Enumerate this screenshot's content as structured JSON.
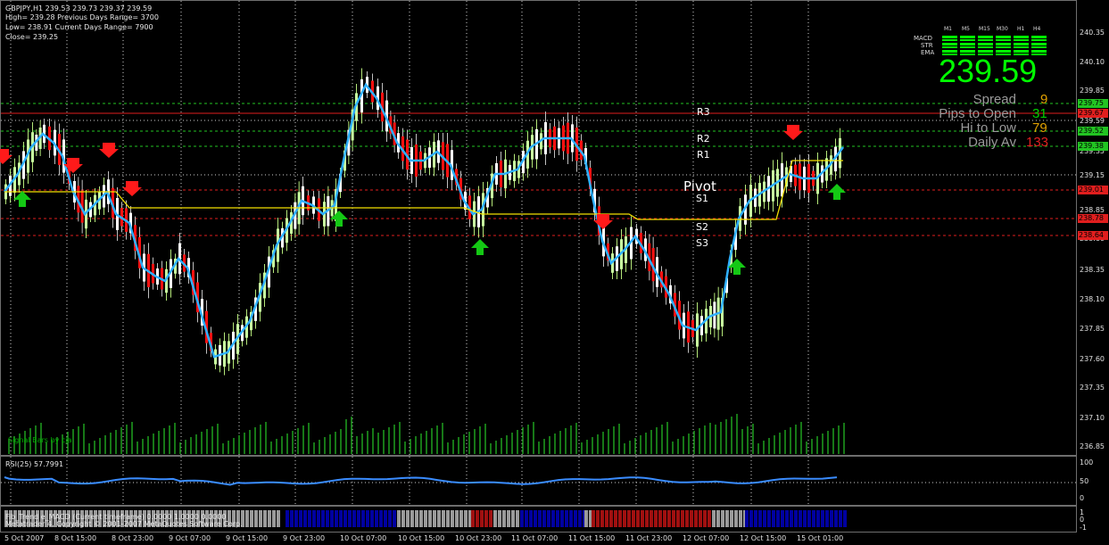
{
  "header": {
    "line1": "GBPJPY,H1  239.53 239.73 239.37 239.59",
    "line2": "High= 239.28    Previous Days Range= 3700",
    "line3": "Low= 238.91    Current Days Range= 7900",
    "line4": "Close= 239.25"
  },
  "indicator_panel": {
    "timeframes": [
      "M1",
      "M5",
      "M15",
      "M30",
      "H1",
      "H4"
    ],
    "rows": [
      "MACD",
      "STR",
      "EMA"
    ],
    "price": "239.59",
    "spread_label": "Spread",
    "spread_value": "9",
    "pips_label": "Pips to Open",
    "pips_value": "31",
    "hilo_label": "Hi to Low",
    "hilo_value": "79",
    "daily_label": "Daily Av",
    "daily_value": "133",
    "colors": {
      "green": "#00ff00",
      "gray": "#9a9a9a",
      "red": "#e02020",
      "orange": "#e0a000"
    }
  },
  "pivot_labels": {
    "r3": "R3",
    "r2": "R2",
    "r1": "R1",
    "pivot": "Pivot",
    "s1": "S1",
    "s2": "S2",
    "s3": "S3"
  },
  "price_axis": [
    "240.35",
    "240.10",
    "239.85",
    "239.59",
    "239.35",
    "239.15",
    "238.85",
    "238.60",
    "238.35",
    "238.10",
    "237.85",
    "237.60",
    "237.35",
    "237.10",
    "236.85"
  ],
  "price_tags": [
    {
      "text": "239.75",
      "color": "#22c422"
    },
    {
      "text": "239.67",
      "color": "#e01e1e"
    },
    {
      "text": "239.52",
      "color": "#22c422"
    },
    {
      "text": "239.38",
      "color": "#22c422"
    },
    {
      "text": "239.01",
      "color": "#e01e1e"
    },
    {
      "text": "238.78",
      "color": "#e01e1e"
    },
    {
      "text": "238.64",
      "color": "#e01e1e"
    }
  ],
  "signal_bars_label": "Signal Bars by cja",
  "rsi": {
    "label": "RSI(25) 57.7991",
    "axis": [
      "100",
      "50",
      "0"
    ]
  },
  "trend": {
    "label": "Fib_Trend e_MACD (Current timeframe) 0.0000 1.0000 0.0000",
    "copyright": "Metatrader 4, Copyright © 2001-2007 MetaQuotes Software Corp.",
    "axis": [
      "1",
      "0",
      "-1"
    ]
  },
  "time_axis": [
    "5 Oct 2007",
    "8 Oct 15:00",
    "8 Oct 23:00",
    "9 Oct 07:00",
    "9 Oct 15:00",
    "9 Oct 23:00",
    "10 Oct 07:00",
    "10 Oct 15:00",
    "10 Oct 23:00",
    "11 Oct 07:00",
    "11 Oct 15:00",
    "11 Oct 23:00",
    "12 Oct 07:00",
    "12 Oct 15:00",
    "15 Oct 01:00"
  ]
}
